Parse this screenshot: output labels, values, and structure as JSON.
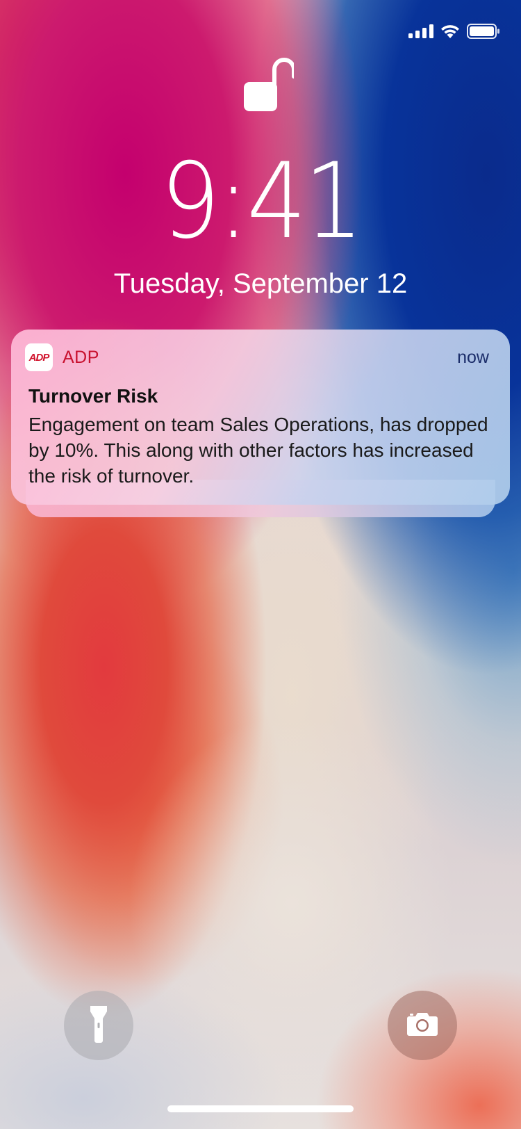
{
  "status_bar": {
    "signal_icon": "cellular-signal-icon",
    "wifi_icon": "wifi-icon",
    "battery_icon": "battery-icon"
  },
  "lock_screen": {
    "lock_icon": "unlocked-padlock-icon",
    "time": "9:41",
    "date": "Tuesday, September 12"
  },
  "notification": {
    "app_name": "ADP",
    "app_icon_text": "ADP",
    "time": "now",
    "title": "Turnover Risk",
    "body": "Engagement on team Sales Operations, has dropped by 10%. This along with other factors has increased the risk of turnover.",
    "accent_color": "#c8102e"
  },
  "controls": {
    "flashlight_icon": "flashlight-icon",
    "camera_icon": "camera-icon"
  }
}
